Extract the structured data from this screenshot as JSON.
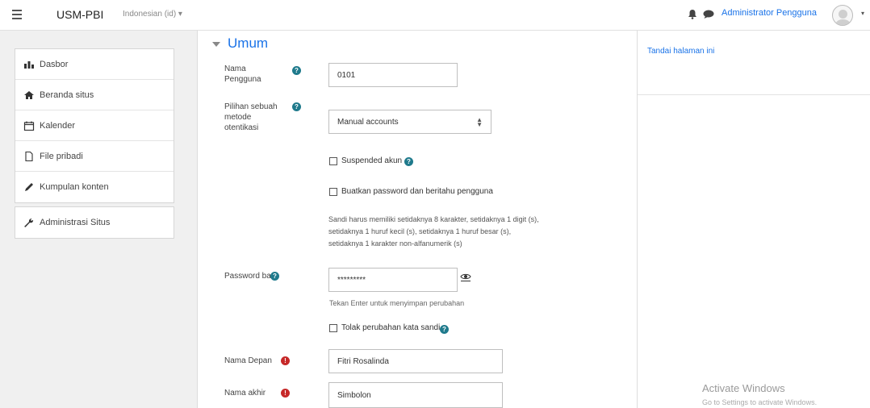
{
  "navbar": {
    "site_name": "USM-PBI",
    "language": "Indonesian (id) ▾",
    "user_name": "Administrator Pengguna",
    "user_caret": "▾",
    "menu_icon": "hamburger-menu-icon",
    "bell_icon": "bell-icon",
    "chat_icon": "chat-bubble-icon"
  },
  "sidebar": {
    "items": [
      {
        "label": "Dasbor",
        "icon": "dashboard-icon"
      },
      {
        "label": "Beranda situs",
        "icon": "home-icon"
      },
      {
        "label": "Kalender",
        "icon": "calendar-icon"
      },
      {
        "label": "File pribadi",
        "icon": "file-icon"
      },
      {
        "label": "Kumpulan konten",
        "icon": "pencil-icon"
      }
    ],
    "admin": {
      "label": "Administrasi Situs",
      "icon": "wrench-icon"
    }
  },
  "right_panel": {
    "text": "Tandai halaman ini"
  },
  "form": {
    "section_title": "Umum",
    "username_label_1": "Nama",
    "username_label_2": "Pengguna",
    "username_value": "0101",
    "auth_label_1": "Pilihan sebuah",
    "auth_label_2": "metode",
    "auth_label_3": "otentikasi",
    "auth_value": "Manual accounts",
    "suspended_label": "Suspended akun",
    "create_password_label": "Buatkan password dan beritahu pengguna",
    "password_policy_1": "Sandi harus memiliki setidaknya 8 karakter, setidaknya 1 digit (s),",
    "password_policy_2": "setidaknya 1 huruf kecil (s), setidaknya 1 huruf besar (s),",
    "password_policy_3": "setidaknya 1 karakter non-alfanumerik (s)",
    "new_password_label": "Password baru",
    "new_password_value": "*********",
    "password_hint": "Tekan Enter untuk menyimpan perubahan",
    "reject_change_label": "Tolak perubahan kata sandi",
    "first_name_label": "Nama Depan",
    "first_name_value": "Fitri Rosalinda",
    "last_name_label": "Nama akhir",
    "last_name_value": "Simbolon",
    "help_glyph": "?",
    "required_glyph": "!"
  },
  "watermark": {
    "line1": "Activate Windows",
    "line2": "Go to Settings to activate Windows."
  },
  "colors": {
    "accent": "#1a73e8",
    "help": "#1f7a8c",
    "required": "#c62828"
  }
}
